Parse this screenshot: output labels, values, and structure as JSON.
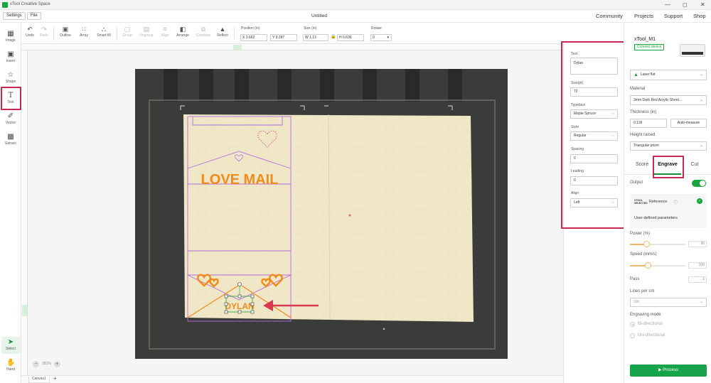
{
  "app": {
    "title": "xTool Creative Space"
  },
  "menu": {
    "settings": "Settings",
    "file": "File",
    "doc_title": "Untitled"
  },
  "top_links": [
    "Community",
    "Projects",
    "Support",
    "Shop"
  ],
  "left_tools": [
    {
      "label": "Image",
      "icon": "image-icon"
    },
    {
      "label": "Insert",
      "icon": "insert-icon"
    },
    {
      "label": "Shape",
      "icon": "shape-icon"
    },
    {
      "label": "Text",
      "icon": "text-icon"
    },
    {
      "label": "Vector",
      "icon": "vector-pen-icon"
    },
    {
      "label": "Extract",
      "icon": "extract-icon"
    },
    {
      "label": "Select",
      "icon": "select-cursor-icon"
    },
    {
      "label": "Hand",
      "icon": "hand-icon"
    }
  ],
  "toolbar": {
    "undo": "Undo",
    "redo": "Redo",
    "outline": "Outline",
    "array": "Array",
    "smart_fill": "Smart fill",
    "group": "Group",
    "ungroup": "Ungroup",
    "align": "Align",
    "arrange": "Arrange",
    "combine": "Combine",
    "reflect": "Reflect",
    "position_label": "Position (in)",
    "pos_x": "X 3.662",
    "pos_y": "Y 9.287",
    "size_label": "Size (in)",
    "size_w": "W 1.13",
    "size_h": "H 0.636",
    "rotate_label": "Rotate",
    "rotate_value": "0"
  },
  "canvas": {
    "zoom": "281%",
    "tab": "Canvas1",
    "design_text": "LOVE MAIL",
    "selected_text": "DYLAN"
  },
  "text_panel": {
    "text_label": "Text",
    "text_value": "Dylan",
    "size_label": "Size(pt)",
    "size_value": "72",
    "typeface_label": "Typeface",
    "typeface_value": "Maple Spruce",
    "style_label": "Style",
    "style_value": "Regular",
    "spacing_label": "Spacing",
    "spacing_value": "0",
    "leading_label": "Leading",
    "leading_value": "0",
    "align_label": "Align",
    "align_value": "Left"
  },
  "device": {
    "name": "xTool_M1",
    "connect": "Connect device",
    "mode": "Laser flat",
    "material_label": "Material",
    "material_value": "3mm Dark Red Acrylic Sheet...",
    "thickness_label": "Thickness (in)",
    "thickness_value": "0.118",
    "auto_measure": "Auto-measure",
    "height_label": "Height raised",
    "height_value": "Triangular prism",
    "tabs": [
      "Score",
      "Engrave",
      "Cut"
    ],
    "output_label": "Output",
    "reference_brand": "XTOOL SELECTED",
    "reference_label": "Reference",
    "user_params": "User-defined parameters",
    "power_label": "Power (%)",
    "power_value": 30,
    "speed_label": "Speed (mm/s)",
    "speed_value": 100,
    "pass_label": "Pass",
    "pass_value": "1",
    "lines_label": "Lines per cm",
    "lines_value": "100",
    "mode_label": "Engraving mode",
    "bidirectional": "Bi-directional",
    "unidirectional": "Uni-directional",
    "process": "Process"
  },
  "colors": {
    "accent": "#16a34a",
    "highlight": "#c8284f",
    "engrave_orange": "#f28b1e",
    "cut_purple": "#a24bd6"
  }
}
